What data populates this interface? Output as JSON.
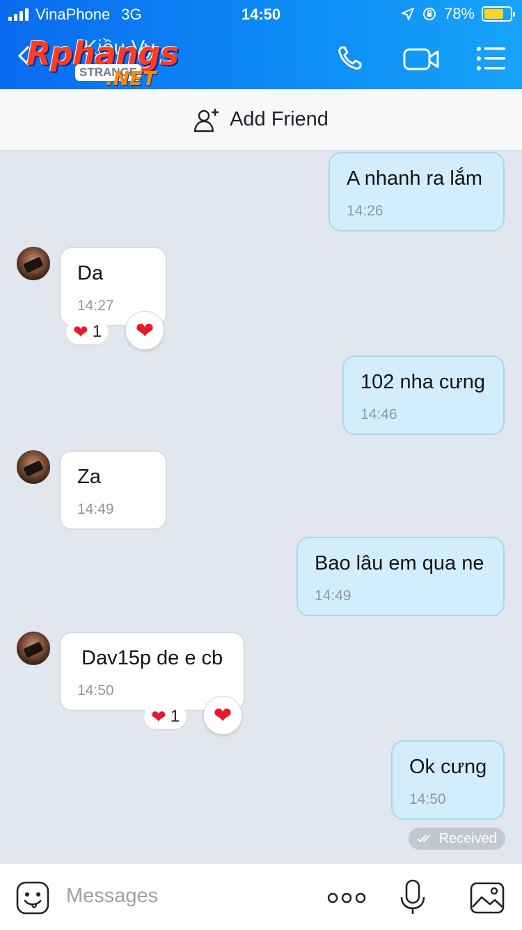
{
  "status_bar": {
    "carrier": "VinaPhone",
    "network": "3G",
    "time": "14:50",
    "battery": "78%",
    "battery_level": 0.78
  },
  "header": {
    "title": "Kiều Vy",
    "logo_text": "Rphangs",
    "logo_badge": "STRANGE",
    "logo_suffix": ".NET",
    "icons": [
      "back-icon",
      "phone-icon",
      "video-icon",
      "menu-icon"
    ]
  },
  "add_friend": {
    "label": "Add Friend",
    "icon": "add-user-icon"
  },
  "messages": [
    {
      "text": "A nhanh ra lắm",
      "time": "14:26",
      "sender": "me"
    },
    {
      "text": "Da",
      "time": "14:27",
      "sender": "them",
      "reaction": {
        "emoji": "❤",
        "count": "1"
      }
    },
    {
      "text": "102 nha cưng",
      "time": "14:46",
      "sender": "me"
    },
    {
      "text": "Za",
      "time": "14:49",
      "sender": "them"
    },
    {
      "text": "Bao lâu em qua ne",
      "time": "14:49",
      "sender": "me"
    },
    {
      "text": "Dav15p de e cb",
      "time": "14:50",
      "sender": "them",
      "reaction": {
        "emoji": "❤",
        "count": "1"
      }
    },
    {
      "text": "Ok cưng",
      "time": "14:50",
      "sender": "me"
    }
  ],
  "delivery_status": "Received",
  "input": {
    "placeholder": "Messages"
  },
  "colors": {
    "header_blue": "#0a6bf0",
    "outgoing_bubble": "#d2eefc",
    "incoming_bubble": "#ffffff",
    "heart": "#e8192c",
    "chat_bg": "#e2e6ee"
  }
}
